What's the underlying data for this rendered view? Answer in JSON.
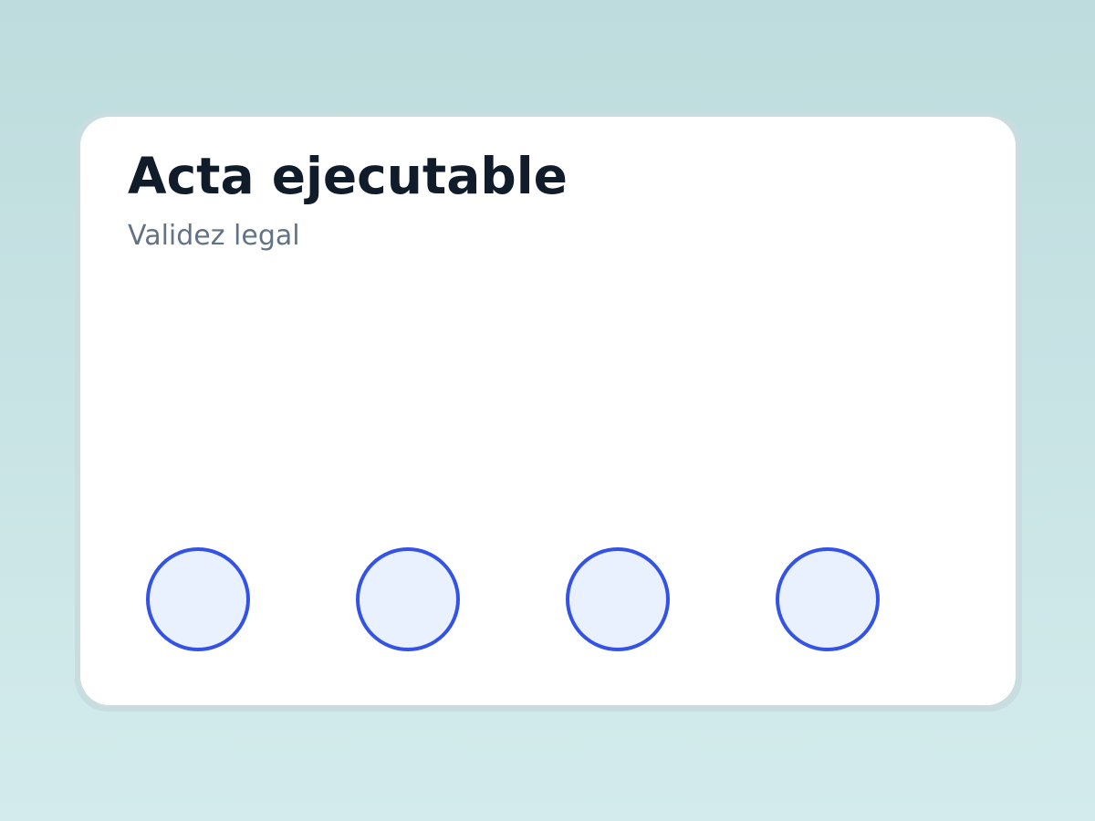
{
  "card": {
    "title": "Acta ejecutable",
    "subtitle": "Validez legal"
  },
  "steps": [
    {
      "label": ""
    },
    {
      "label": ""
    },
    {
      "label": ""
    },
    {
      "label": ""
    }
  ],
  "colors": {
    "accent": "#3453e6",
    "step_fill": "#e8f1fd",
    "title": "#111c2b",
    "subtitle": "#627385",
    "background_top": "#bedcdd",
    "background_bottom": "#d3ebec"
  }
}
